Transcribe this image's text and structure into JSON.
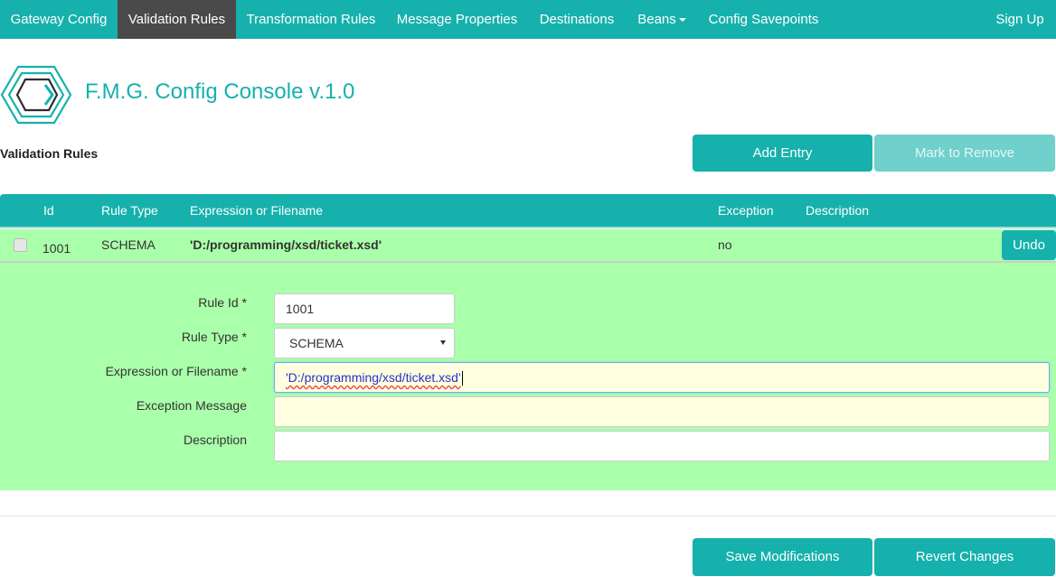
{
  "nav": {
    "items": [
      {
        "label": "Gateway Config"
      },
      {
        "label": "Validation Rules"
      },
      {
        "label": "Transformation Rules"
      },
      {
        "label": "Message Properties"
      },
      {
        "label": "Destinations"
      },
      {
        "label": "Beans"
      },
      {
        "label": "Config Savepoints"
      }
    ],
    "active": "Validation Rules",
    "sign_up": "Sign Up"
  },
  "app": {
    "title": "F.M.G. Config Console v.1.0",
    "accent_color": "#16b1ac",
    "logo_icon": "hexagon-chevron-logo"
  },
  "section": {
    "title": "Validation Rules",
    "add_entry": "Add Entry",
    "mark_to_remove": "Mark to Remove",
    "mark_to_remove_disabled": true
  },
  "table": {
    "columns": [
      "Id",
      "Rule Type",
      "Expression or Filename",
      "Exception",
      "Description"
    ],
    "rows": [
      {
        "id": "1001",
        "rule_type": "SCHEMA",
        "expression": "'D:/programming/xsd/ticket.xsd'",
        "exception": "no",
        "description": "",
        "checked": false,
        "action": "Undo",
        "row_color": "#aaffaa"
      }
    ]
  },
  "form": {
    "rule_id_label": "Rule Id *",
    "rule_id_value": "1001",
    "rule_type_label": "Rule Type *",
    "rule_type_value": "SCHEMA",
    "expression_label": "Expression or Filename *",
    "expression_value": "'D:/programming/xsd/ticket.xsd'",
    "exception_label": "Exception Message",
    "exception_value": "",
    "description_label": "Description",
    "description_value": ""
  },
  "footer": {
    "save": "Save Modifications",
    "revert": "Revert Changes"
  }
}
